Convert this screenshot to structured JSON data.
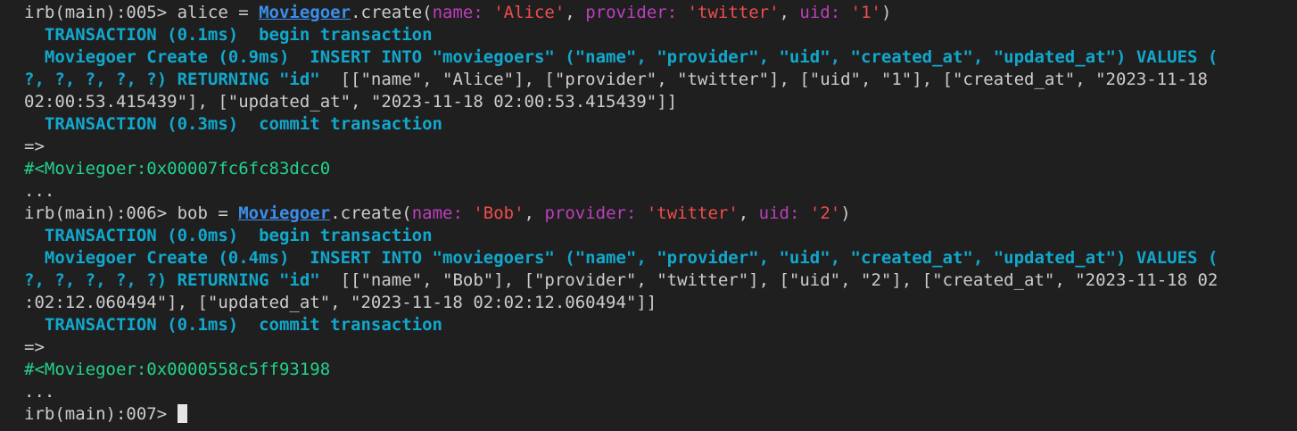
{
  "terminal": {
    "cmd1": {
      "prompt": "irb(main):005> ",
      "var": "alice = ",
      "model": "Moviegoer",
      "method": ".create(",
      "k1": "name: ",
      "v1": "'Alice'",
      "sep1": ", ",
      "k2": "provider: ",
      "v2": "'twitter'",
      "sep2": ", ",
      "k3": "uid: ",
      "v3": "'1'",
      "close": ")"
    },
    "out1": {
      "tx_begin": "  TRANSACTION (0.1ms)  begin transaction",
      "create_a": "  Moviegoer Create (0.9ms)  INSERT INTO \"moviegoers\" (\"name\", \"provider\", \"uid\", \"created_at\", \"updated_at\") VALUES (",
      "create_b_sql": "?, ?, ?, ?, ?) RETURNING \"id\"",
      "create_b_plain": "  [[\"name\", \"Alice\"], [\"provider\", \"twitter\"], [\"uid\", \"1\"], [\"created_at\", \"2023-11-18",
      "create_c": "02:00:53.415439\"], [\"updated_at\", \"2023-11-18 02:00:53.415439\"]]",
      "tx_commit": "  TRANSACTION (0.3ms)  commit transaction",
      "arrow": "=>",
      "object": "#<Moviegoer:0x00007fc6fc83dcc0",
      "ellipsis": "..."
    },
    "cmd2": {
      "prompt": "irb(main):006> ",
      "var": "bob = ",
      "model": "Moviegoer",
      "method": ".create(",
      "k1": "name: ",
      "v1": "'Bob'",
      "sep1": ", ",
      "k2": "provider: ",
      "v2": "'twitter'",
      "sep2": ", ",
      "k3": "uid: ",
      "v3": "'2'",
      "close": ")"
    },
    "out2": {
      "tx_begin": "  TRANSACTION (0.0ms)  begin transaction",
      "create_a": "  Moviegoer Create (0.4ms)  INSERT INTO \"moviegoers\" (\"name\", \"provider\", \"uid\", \"created_at\", \"updated_at\") VALUES (",
      "create_b_sql": "?, ?, ?, ?, ?) RETURNING \"id\"",
      "create_b_plain": "  [[\"name\", \"Bob\"], [\"provider\", \"twitter\"], [\"uid\", \"2\"], [\"created_at\", \"2023-11-18 02",
      "create_c": ":02:12.060494\"], [\"updated_at\", \"2023-11-18 02:02:12.060494\"]]",
      "tx_commit": "  TRANSACTION (0.1ms)  commit transaction",
      "arrow": "=>",
      "object": "#<Moviegoer:0x0000558c5ff93198",
      "ellipsis": "..."
    },
    "current_prompt": "irb(main):007> "
  },
  "colors": {
    "background": "#1f1f1f",
    "foreground": "#cccccc",
    "model": "#3b8eea",
    "keyword_arg": "#bc3fbc",
    "string": "#f14c4c",
    "sql_log": "#11a8cd",
    "object_inspect": "#23d18b"
  }
}
